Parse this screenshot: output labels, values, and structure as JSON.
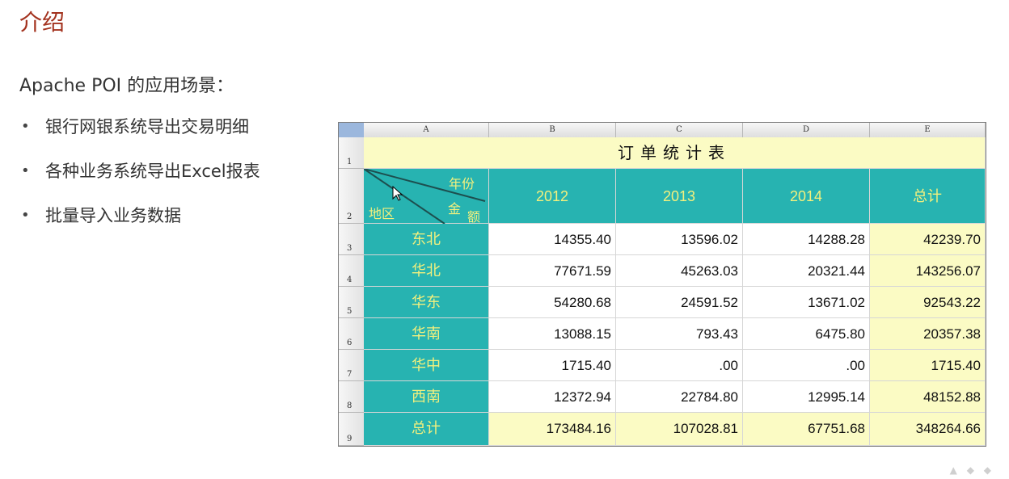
{
  "slide": {
    "title": "介绍",
    "intro": "Apache POI 的应用场景：",
    "bullets": [
      "银行网银系统导出交易明细",
      "各种业务系统导出Excel报表",
      "批量导入业务数据"
    ],
    "bullet_glyph": "•"
  },
  "sheet": {
    "columns": [
      "A",
      "B",
      "C",
      "D",
      "E"
    ],
    "row_numbers": [
      "1",
      "2",
      "3",
      "4",
      "5",
      "6",
      "7",
      "8",
      "9"
    ],
    "title": "订单统计表",
    "corner_labels": {
      "year": "年份",
      "amount_1": "金",
      "amount_2": "额",
      "region": "地区"
    },
    "headers": [
      "2012",
      "2013",
      "2014",
      "总计"
    ],
    "rows": [
      {
        "region": "东北",
        "values": [
          "14355.40",
          "13596.02",
          "14288.28",
          "42239.70"
        ]
      },
      {
        "region": "华北",
        "values": [
          "77671.59",
          "45263.03",
          "20321.44",
          "143256.07"
        ]
      },
      {
        "region": "华东",
        "values": [
          "54280.68",
          "24591.52",
          "13671.02",
          "92543.22"
        ]
      },
      {
        "region": "华南",
        "values": [
          "13088.15",
          "793.43",
          "6475.80",
          "20357.38"
        ]
      },
      {
        "region": "华中",
        "values": [
          "1715.40",
          ".00",
          ".00",
          "1715.40"
        ]
      },
      {
        "region": "西南",
        "values": [
          "12372.94",
          "22784.80",
          "12995.14",
          "48152.88"
        ]
      }
    ],
    "total": {
      "region": "总计",
      "values": [
        "173484.16",
        "107028.81",
        "67751.68",
        "348264.66"
      ]
    },
    "colors": {
      "teal": "#27b3b1",
      "cream": "#fbfbc4",
      "label_yellow": "#f3f07d"
    }
  }
}
